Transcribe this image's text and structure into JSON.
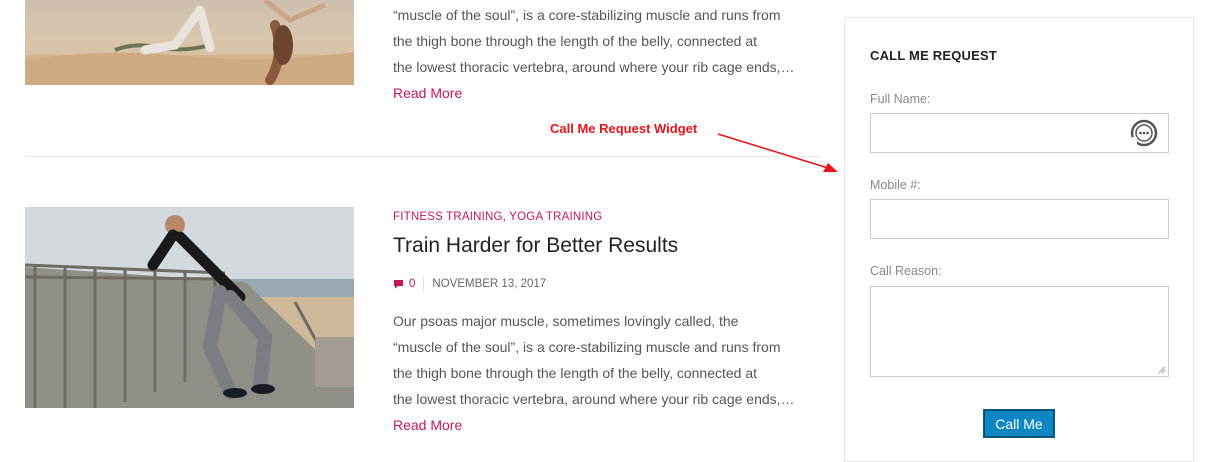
{
  "posts": [
    {
      "excerpt_lines": [
        "“muscle of the soul”, is a core-stabilizing muscle and runs from",
        "the thigh bone through the length of the belly, connected at",
        "the lowest thoracic vertebra, around where your rib cage ends,…"
      ],
      "read_more": "Read More"
    },
    {
      "categories": [
        "FITNESS TRAINING",
        "YOGA TRAINING"
      ],
      "title": "Train Harder for Better Results",
      "comment_count": "0",
      "date": "NOVEMBER 13, 2017",
      "excerpt_lines": [
        "Our psoas major muscle, sometimes lovingly called, the",
        "“muscle of the soul”, is a core-stabilizing muscle and runs from",
        "the thigh bone through the length of the belly, connected at",
        "the lowest thoracic vertebra, around where your rib cage ends,…"
      ],
      "read_more": "Read More"
    }
  ],
  "annotation": {
    "text": "Call Me Request Widget",
    "color": "#e8141a"
  },
  "widget": {
    "title": "CALL ME REQUEST",
    "full_name_label": "Full Name:",
    "full_name_value": "",
    "mobile_label": "Mobile #:",
    "mobile_value": "",
    "reason_label": "Call Reason:",
    "reason_value": "",
    "button_label": "Call Me",
    "button_color": "#0e87c2"
  },
  "colors": {
    "accent": "#c2185b",
    "heading": "#222222",
    "body_text": "#555555"
  },
  "icons": {
    "comment": "comment-icon",
    "autofill": "password-manager-icon",
    "resize": "resize-grip-icon"
  }
}
